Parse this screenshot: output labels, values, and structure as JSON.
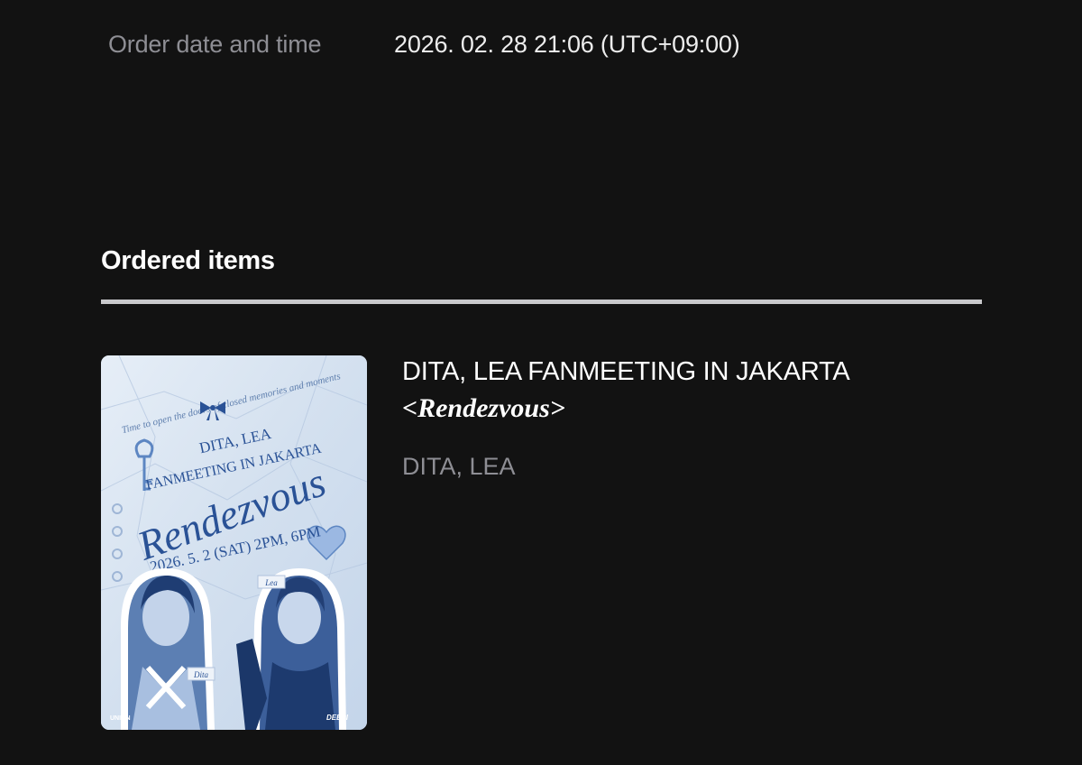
{
  "order": {
    "label": "Order date and time",
    "value": "2026. 02. 28 21:06 (UTC+09:00)"
  },
  "ordered_items": {
    "heading": "Ordered items",
    "items": [
      {
        "title": "DITA, LEA FANMEETING IN JAKARTA",
        "subtitle": "<Rendezvous>",
        "artist": "DITA, LEA",
        "poster": {
          "tagline": "Time to open the doors of closed memories and moments",
          "line1": "DITA, LEA",
          "line2": "FANMEETING IN JAKARTA",
          "script_title": "Rendezvous",
          "date": "2026. 5. 2 (SAT) 2PM, 6PM",
          "name_tag_left": "Dita",
          "name_tag_right": "Lea",
          "logo_left": "UNION",
          "logo_right": "DEEPI"
        }
      }
    ]
  },
  "colors": {
    "background": "#121212",
    "label_gray": "#8e8e94",
    "divider": "#c9c9cc",
    "poster_blue": "#2a5296"
  }
}
